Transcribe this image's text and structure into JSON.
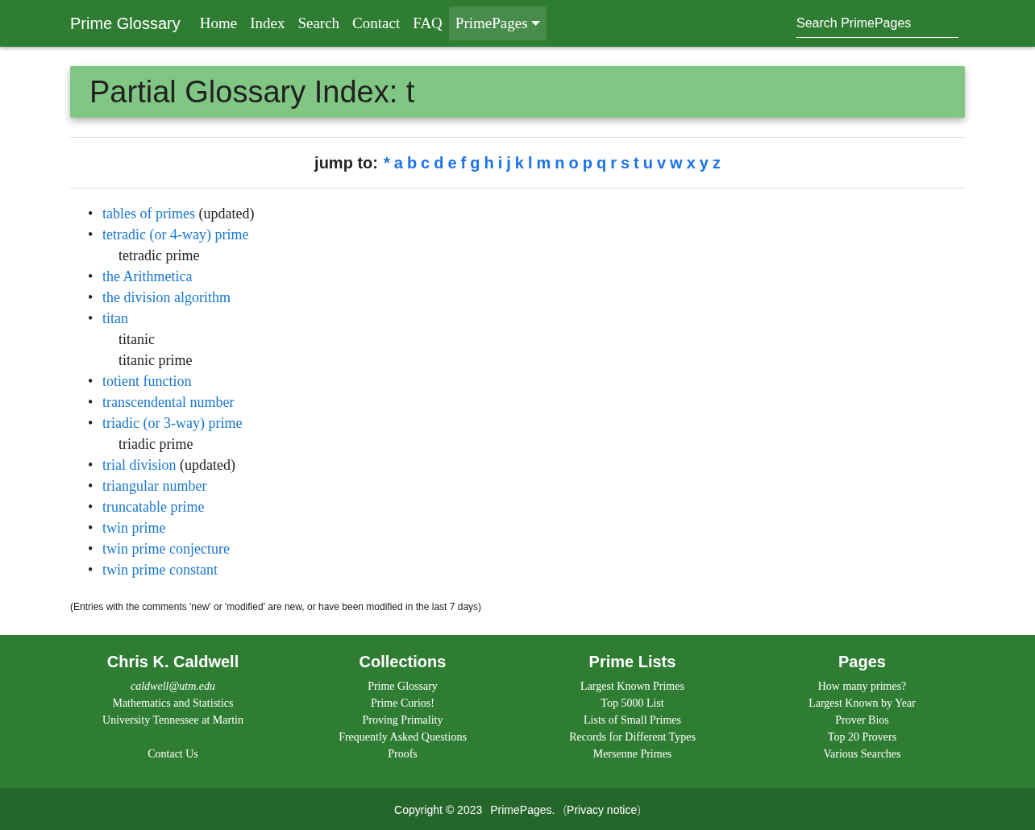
{
  "navbar": {
    "brand": "Prime Glossary",
    "links": [
      {
        "label": "Home",
        "kind": "link",
        "selected": false
      },
      {
        "label": "Index",
        "kind": "link",
        "selected": false
      },
      {
        "label": "Search",
        "kind": "link",
        "selected": false
      },
      {
        "label": "Contact",
        "kind": "link",
        "selected": false
      },
      {
        "label": "FAQ",
        "kind": "link",
        "selected": false
      },
      {
        "label": "PrimePages",
        "kind": "dropdown",
        "selected": true
      }
    ],
    "search": {
      "placeholder": "Search PrimePages"
    }
  },
  "header": {
    "title": "Partial Glossary Index: t"
  },
  "jump": {
    "label": "jump to:",
    "letters": [
      "*",
      "a",
      "b",
      "c",
      "d",
      "e",
      "f",
      "g",
      "h",
      "i",
      "j",
      "k",
      "l",
      "m",
      "n",
      "o",
      "p",
      "q",
      "r",
      "s",
      "t",
      "u",
      "v",
      "w",
      "x",
      "y",
      "z"
    ]
  },
  "entries": [
    {
      "bullet": "•",
      "link": "tables of primes",
      "note": "(updated)"
    },
    {
      "bullet": "•",
      "link": "tetradic (or 4-way) prime",
      "children": [
        "tetradic prime"
      ]
    },
    {
      "bullet": "•",
      "link": "the Arithmetica"
    },
    {
      "bullet": "•",
      "link": "the division algorithm"
    },
    {
      "bullet": "•",
      "link": "titan",
      "children": [
        "titanic",
        "titanic prime"
      ]
    },
    {
      "bullet": "•",
      "link": "totient function"
    },
    {
      "bullet": "•",
      "link": "transcendental number"
    },
    {
      "bullet": "•",
      "link": "triadic (or 3-way) prime",
      "children": [
        "triadic prime"
      ]
    },
    {
      "bullet": "•",
      "link": "trial division",
      "note": "(updated)"
    },
    {
      "bullet": "•",
      "link": "triangular number"
    },
    {
      "bullet": "•",
      "link": "truncatable prime"
    },
    {
      "bullet": "•",
      "link": "twin prime"
    },
    {
      "bullet": "•",
      "link": "twin prime conjecture"
    },
    {
      "bullet": "•",
      "link": "twin prime constant"
    }
  ],
  "footnote": "(Entries with the comments 'new' or 'modified' are new, or have been modified in the last 7 days)",
  "footer": {
    "columns": [
      {
        "title": "Chris K. Caldwell",
        "lines": [
          {
            "text": "caldwell@utm.edu",
            "kind": "email"
          },
          {
            "text": "Mathematics and Statistics",
            "kind": "text"
          },
          {
            "text": "University Tennessee at Martin",
            "kind": "text"
          },
          {
            "text": "Contact Us",
            "kind": "spaced"
          }
        ]
      },
      {
        "title": "Collections",
        "lines": [
          {
            "text": "Prime Glossary",
            "kind": "text"
          },
          {
            "text": "Prime Curios!",
            "kind": "text"
          },
          {
            "text": "Proving Primality",
            "kind": "text"
          },
          {
            "text": "Frequently Asked Questions",
            "kind": "text"
          },
          {
            "text": "Proofs",
            "kind": "text"
          }
        ]
      },
      {
        "title": "Prime Lists",
        "lines": [
          {
            "text": "Largest Known Primes",
            "kind": "text"
          },
          {
            "text": "Top 5000 List",
            "kind": "text"
          },
          {
            "text": "Lists of Small Primes",
            "kind": "text"
          },
          {
            "text": "Records for Different Types",
            "kind": "text"
          },
          {
            "text": "Mersenne Primes",
            "kind": "text"
          }
        ]
      },
      {
        "title": "Pages",
        "lines": [
          {
            "text": "How many primes?",
            "kind": "text"
          },
          {
            "text": "Largest Known by Year",
            "kind": "text"
          },
          {
            "text": "Prover Bios",
            "kind": "text"
          },
          {
            "text": "Top 20 Provers",
            "kind": "text"
          },
          {
            "text": "Various Searches",
            "kind": "text"
          }
        ]
      }
    ]
  },
  "copyright": {
    "text": "Copyright © 2023",
    "site": "PrimePages.",
    "open": "(",
    "privacy": "Privacy notice",
    "close": ")"
  }
}
